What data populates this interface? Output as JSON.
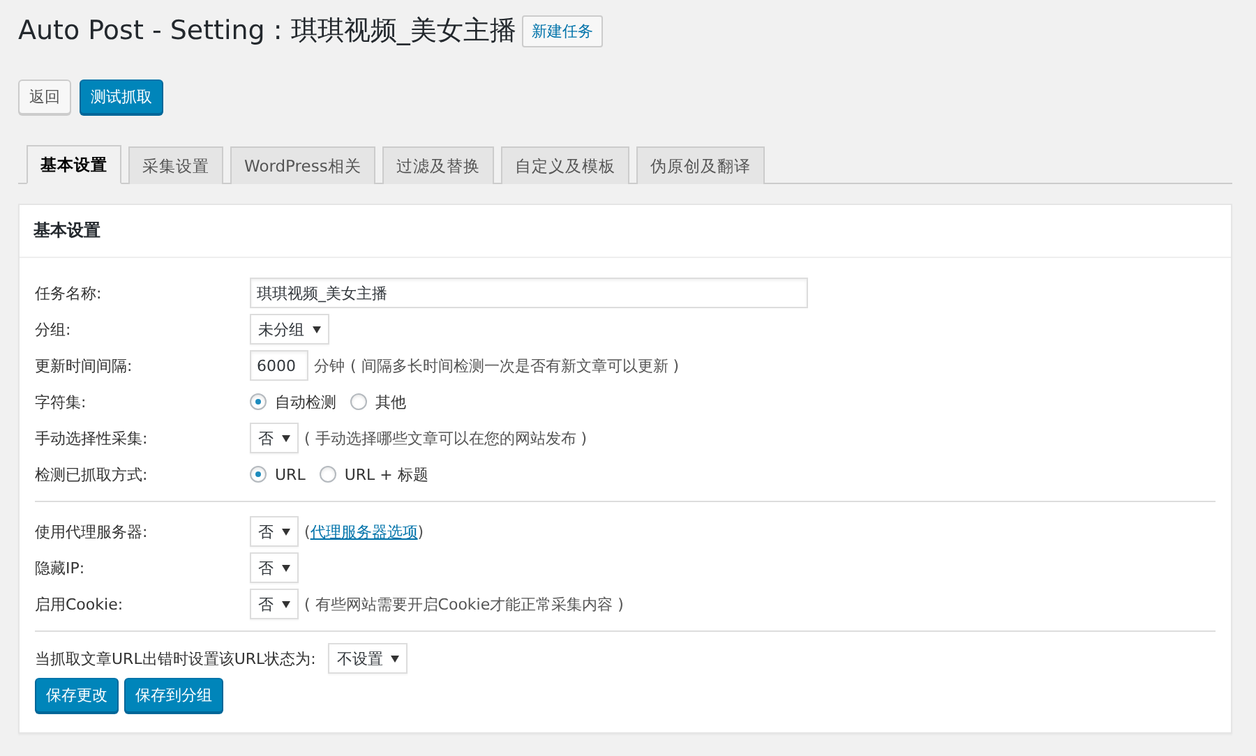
{
  "page_title": "Auto Post - Setting : 琪琪视频_美女主播",
  "title_button": "新建任务",
  "actions": [
    {
      "label": "返回",
      "primary": false
    },
    {
      "label": "测试抓取",
      "primary": true
    }
  ],
  "tabs": [
    {
      "label": "基本设置",
      "selected": true
    },
    {
      "label": "采集设置",
      "selected": false
    },
    {
      "label": "WordPress相关",
      "selected": false
    },
    {
      "label": "过滤及替换",
      "selected": false
    },
    {
      "label": "自定义及模板",
      "selected": false
    },
    {
      "label": "伪原创及翻译",
      "selected": false
    }
  ],
  "panel": {
    "title": "基本设置",
    "groups": [
      {
        "rows": [
          {
            "label": "任务名称:",
            "kind": "text",
            "value": "琪琪视频_美女主播"
          },
          {
            "label": "分组:",
            "kind": "select",
            "value": "未分组"
          },
          {
            "label": "更新时间间隔:",
            "kind": "number",
            "value": "6000",
            "suffix": "分钟",
            "note": "( 间隔多长时间检测一次是否有新文章可以更新 )"
          },
          {
            "label": "字符集:",
            "kind": "radio",
            "options": [
              {
                "label": "自动检测",
                "selected": true
              },
              {
                "label": "其他",
                "selected": false
              }
            ]
          },
          {
            "label": "手动选择性采集:",
            "kind": "select",
            "value": "否",
            "note": "( 手动选择哪些文章可以在您的网站发布 )"
          },
          {
            "label": "检测已抓取方式:",
            "kind": "radio",
            "options": [
              {
                "label": "URL",
                "selected": true
              },
              {
                "label": "URL + 标题",
                "selected": false
              }
            ]
          }
        ]
      },
      {
        "rows": [
          {
            "label": "使用代理服务器:",
            "kind": "select",
            "value": "否",
            "link": {
              "before": "(",
              "text": "代理服务器选项",
              "after": ")"
            }
          },
          {
            "label": "隐藏IP:",
            "kind": "select",
            "value": "否"
          },
          {
            "label": "启用Cookie:",
            "kind": "select",
            "value": "否",
            "note": "( 有些网站需要开启Cookie才能正常采集内容 )"
          }
        ]
      }
    ],
    "error_setting": {
      "label": "当抓取文章URL出错时设置该URL状态为:",
      "value": "不设置"
    },
    "buttons": [
      "保存更改",
      "保存到分组"
    ]
  }
}
